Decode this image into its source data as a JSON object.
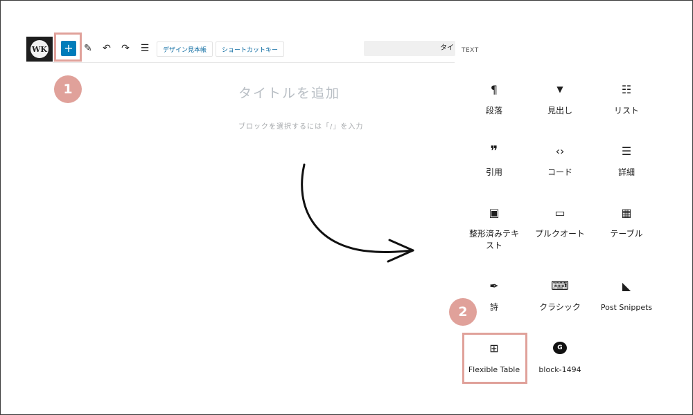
{
  "toolbar": {
    "logo_text": "WK",
    "inserter_label": "+",
    "tools": [
      {
        "icon": "pencil-icon",
        "glyph": "✎"
      },
      {
        "icon": "undo-icon",
        "glyph": "↶"
      },
      {
        "icon": "redo-icon",
        "glyph": "↷"
      },
      {
        "icon": "list-view-icon",
        "glyph": "☰"
      }
    ],
    "design_sample_label": "デザイン見本帳",
    "shortcut_key_label": "ショートカットキー",
    "title_field_text": "タイ"
  },
  "steps": {
    "step1": "1",
    "step2": "2"
  },
  "editor": {
    "title_placeholder": "タイトルを追加",
    "block_placeholder": "ブロックを選択するには「/」を入力"
  },
  "inserter_panel": {
    "category_label": "TEXT",
    "blocks": [
      {
        "label": "段落",
        "icon": "paragraph-icon",
        "glyph": "¶"
      },
      {
        "label": "見出し",
        "icon": "heading-bookmark-icon",
        "glyph": "▼"
      },
      {
        "label": "リスト",
        "icon": "list-icon",
        "glyph": "☷"
      },
      {
        "label": "引用",
        "icon": "quote-icon",
        "glyph": "❞"
      },
      {
        "label": "コード",
        "icon": "code-icon",
        "glyph": "‹›"
      },
      {
        "label": "詳細",
        "icon": "details-icon",
        "glyph": "☰"
      },
      {
        "label": "整形済みテキスト",
        "icon": "preformatted-icon",
        "glyph": "▣"
      },
      {
        "label": "プルクオート",
        "icon": "pullquote-icon",
        "glyph": "▭"
      },
      {
        "label": "テーブル",
        "icon": "table-icon",
        "glyph": "▦"
      },
      {
        "label": "詩",
        "icon": "verse-feather-icon",
        "glyph": "✒"
      },
      {
        "label": "クラシック",
        "icon": "keyboard-icon",
        "glyph": "⌨"
      },
      {
        "label": "Post Snippets",
        "icon": "plug-icon",
        "glyph": "◣"
      },
      {
        "label": "Flexible Table",
        "icon": "flexible-table-icon",
        "glyph": "⊞"
      },
      {
        "label": "block-1494",
        "icon": "gutenberg-g-icon",
        "glyph": "G"
      }
    ]
  },
  "colors": {
    "accent": "#007cba",
    "highlight": "#e0a19a"
  }
}
